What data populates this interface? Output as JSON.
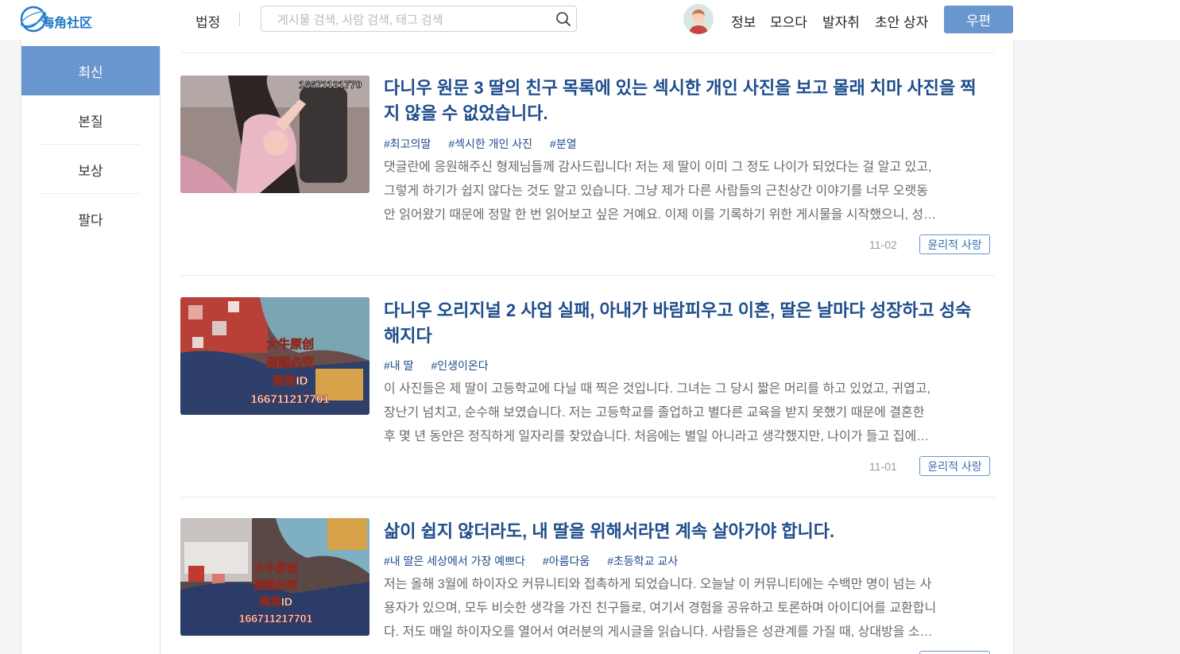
{
  "header": {
    "logo_text": "海角社区",
    "nav_law": "법정",
    "search_placeholder": "게시물 검색, 사람 검색, 태그 검색",
    "links": [
      "정보",
      "모으다",
      "발자취",
      "초안 상자"
    ],
    "write_button": "우편"
  },
  "sidebar": {
    "items": [
      {
        "label": "최신",
        "active": true
      },
      {
        "label": "본질",
        "active": false
      },
      {
        "label": "보상",
        "active": false
      },
      {
        "label": "팔다",
        "active": false
      }
    ]
  },
  "posts": [
    {
      "title_lines": [
        "다니우 원문 3 딸의 친구 목록에 있는 섹시한 개인 사진을 보고 몰래 치마 사진을 찍",
        "지 않을 수 없었습니다."
      ],
      "tags": [
        "#최고의딸",
        "#섹시한 개인 사진",
        "#분열"
      ],
      "excerpt_lines": [
        "댓글란에 응원해주신 형제님들께 감사드립니다! 저는 제 딸이 이미 그 정도 나이가 되었다는 걸 알고 있고,",
        "그렇게 하기가 쉽지 않다는 것도 알고 있습니다. 그냥 제가 다른 사람들의 근친상간 이야기를 너무 오랫동",
        "안 읽어왔기 때문에 정말 한 번 읽어보고 싶은 거예요. 이제 이를 기록하기 위한 게시물을 시작했으니, 성…"
      ],
      "date": "11-02",
      "category": "윤리적 사랑",
      "thumb_watermark": "16671121770"
    },
    {
      "title_lines": [
        "다니우 오리지널 2 사업 실패, 아내가 바람피우고 이혼, 딸은 날마다 성장하고 성숙",
        "해지다"
      ],
      "tags": [
        "#내 딸",
        "#인생이온다"
      ],
      "excerpt_lines": [
        "이 사진들은 제 딸이 고등학교에 다닐 때 찍은 것입니다. 그녀는 그 당시 짧은 머리를 하고 있었고, 귀엽고,",
        "장난기 넘치고, 순수해 보였습니다. 저는 고등학교를 졸업하고 별다른 교육을 받지 못했기 때문에 결혼한",
        "후 몇 년 동안은 정직하게 일자리를 찾았습니다. 처음에는 별일 아니라고 생각했지만, 나이가 들고 집에…"
      ],
      "date": "11-01",
      "category": "윤리적 사랑",
      "thumb_watermark_lines": [
        "大牛原创",
        "盗图必究",
        "海角ID",
        "166711217701"
      ]
    },
    {
      "title_lines": [
        "삶이 쉽지 않더라도, 내 딸을 위해서라면 계속 살아가야 합니다."
      ],
      "tags": [
        "#내 딸은 세상에서 가장 예쁘다",
        "#아름다움",
        "#초등학교 교사"
      ],
      "excerpt_lines": [
        "저는 올해 3월에 하이자오 커뮤니티와 접촉하게 되었습니다. 오늘날 이 커뮤니티에는 수백만 명이 넘는 사",
        "용자가 있으며, 모두 비슷한 생각을 가진 친구들로, 여기서 경험을 공유하고 토론하며 아이디어를 교환합니",
        "다. 저도 매일 하이자오를 열어서 여러분의 게시글을 읽습니다. 사람들은 성관계를 가질 때, 상대방을 소…"
      ],
      "thumb_watermark_lines": [
        "大牛原创",
        "盗图必究",
        "海角ID",
        "166711217701"
      ]
    }
  ],
  "colors": {
    "accent": "#6996cf",
    "title": "#1e4d8c",
    "excerpt": "#6a6a6a",
    "background": "#f5f5f5"
  }
}
